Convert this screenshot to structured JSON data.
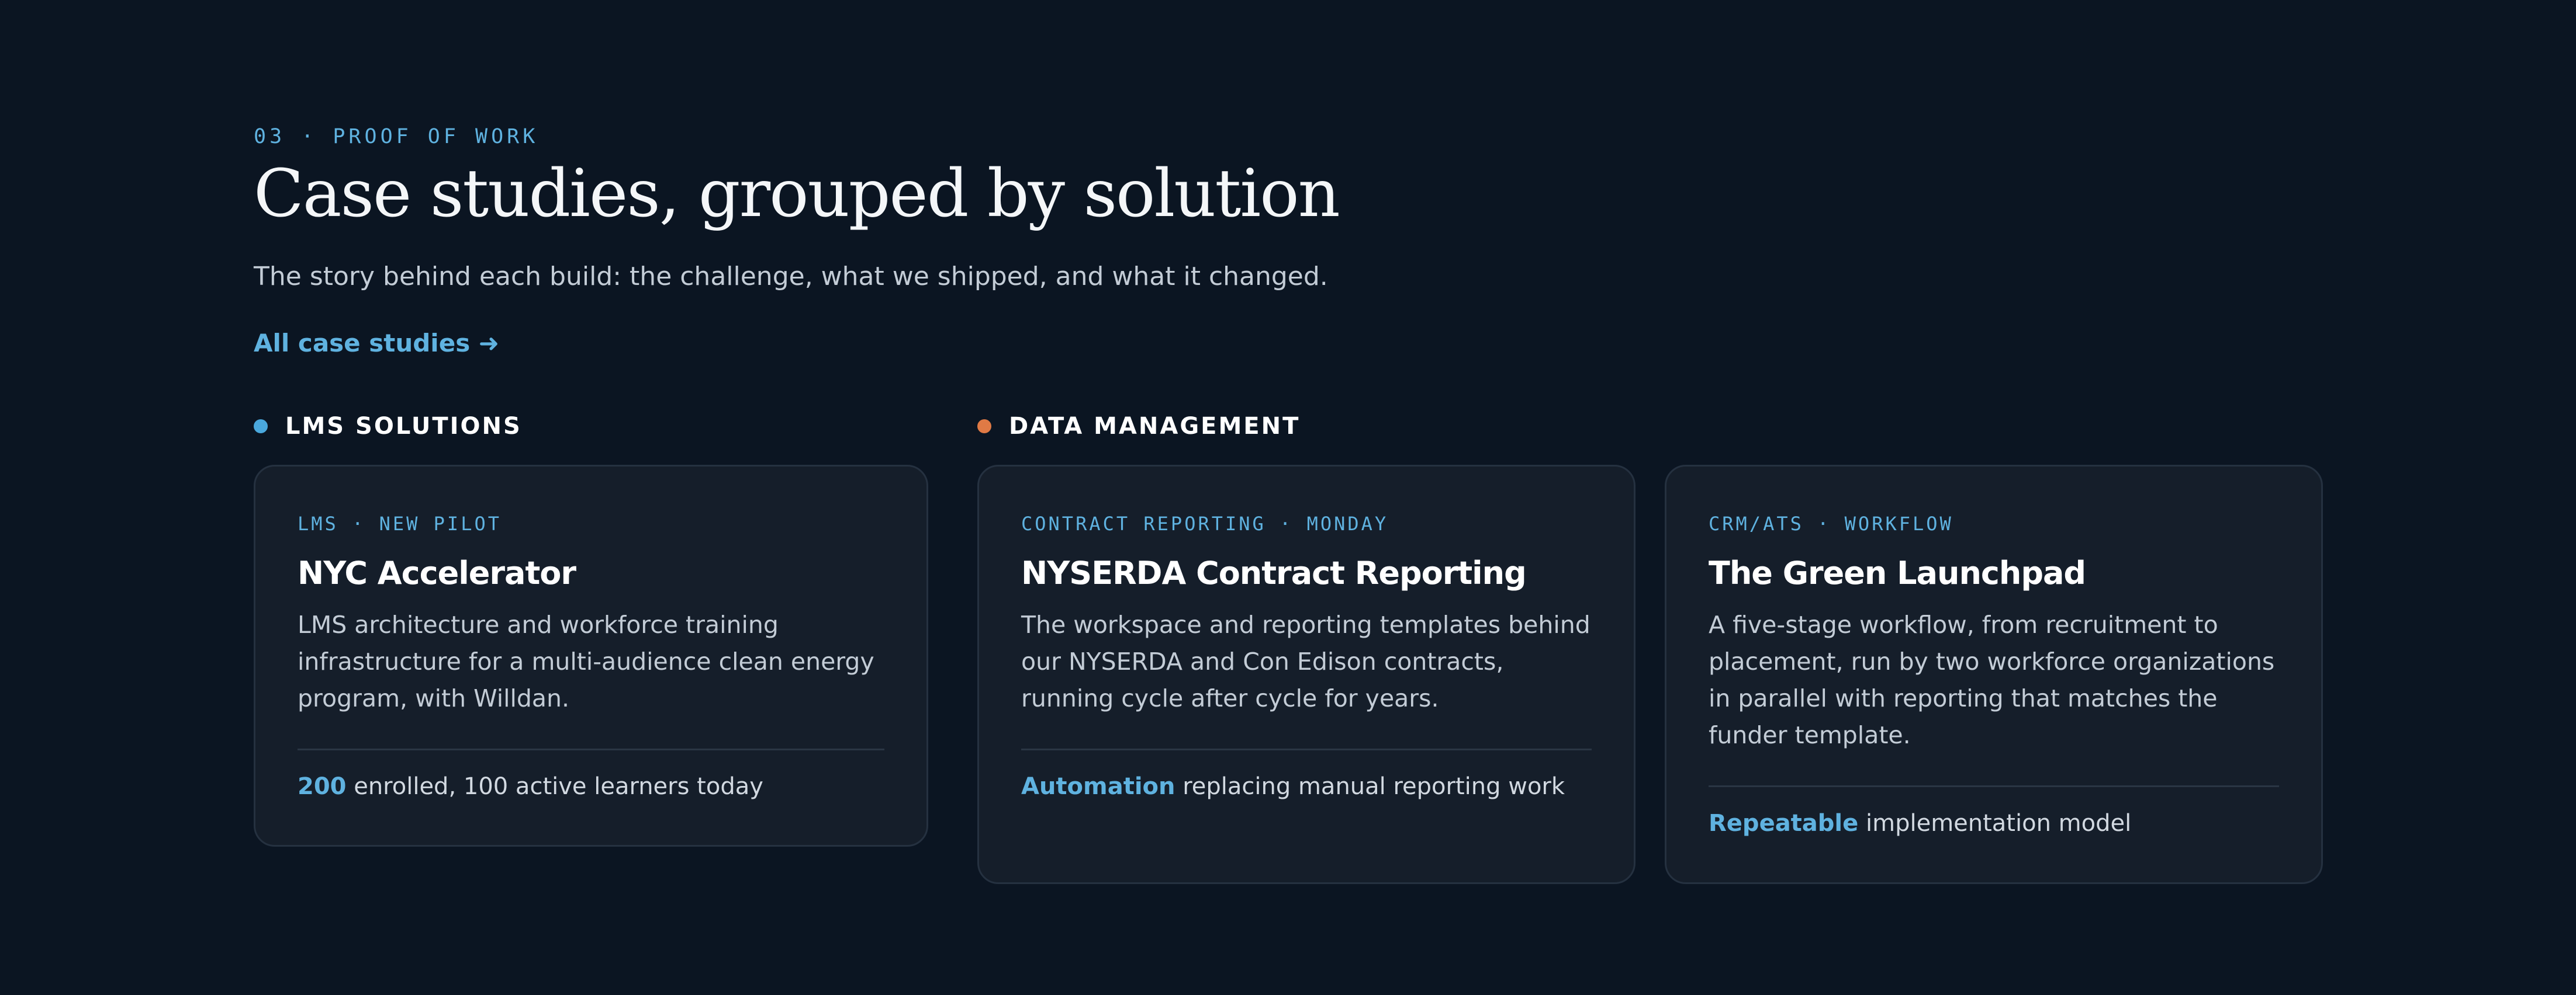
{
  "section": {
    "eyebrow": "03 · PROOF OF WORK",
    "title": "Case studies, grouped by solution",
    "subtitle": "The story behind each build: the challenge, what we shipped, and what it changed.",
    "all_link": "All case studies ➜"
  },
  "groups": [
    {
      "label": "LMS SOLUTIONS",
      "dot_color": "#4aa8dd"
    },
    {
      "label": "DATA MANAGEMENT",
      "dot_color": "#e07a45"
    }
  ],
  "cards": [
    {
      "kicker": "LMS · NEW PILOT",
      "title": "NYC Accelerator",
      "description": "LMS architecture and workforce training infrastructure for a multi-audience clean energy program, with Willdan.",
      "metric_highlight": "200",
      "metric_rest": " enrolled, 100 active learners today"
    },
    {
      "kicker": "CONTRACT REPORTING · MONDAY",
      "title": "NYSERDA Contract Reporting",
      "description": "The workspace and reporting templates behind our NYSERDA and Con Edison contracts, running cycle after cycle for years.",
      "metric_highlight": "Automation",
      "metric_rest": " replacing manual reporting work"
    },
    {
      "kicker": "CRM/ATS · WORKFLOW",
      "title": "The Green Launchpad",
      "description": "A five-stage workflow, from recruitment to placement, run by two workforce organizations in parallel with reporting that matches the funder template.",
      "metric_highlight": "Repeatable",
      "metric_rest": " implementation model"
    }
  ],
  "colors": {
    "background": "#0b1522",
    "card": "#151e2a",
    "accent": "#5fb2e0"
  }
}
